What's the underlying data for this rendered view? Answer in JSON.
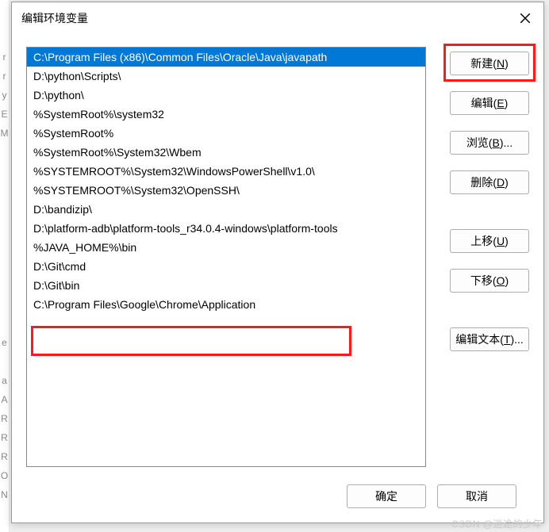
{
  "dialog": {
    "title": "编辑环境变量"
  },
  "list": {
    "items": [
      "C:\\Program Files (x86)\\Common Files\\Oracle\\Java\\javapath",
      "D:\\python\\Scripts\\",
      "D:\\python\\",
      "%SystemRoot%\\system32",
      "%SystemRoot%",
      "%SystemRoot%\\System32\\Wbem",
      "%SYSTEMROOT%\\System32\\WindowsPowerShell\\v1.0\\",
      "%SYSTEMROOT%\\System32\\OpenSSH\\",
      "D:\\bandizip\\",
      "D:\\platform-adb\\platform-tools_r34.0.4-windows\\platform-tools",
      "%JAVA_HOME%\\bin",
      "D:\\Git\\cmd",
      "D:\\Git\\bin",
      "C:\\Program Files\\Google\\Chrome\\Application"
    ],
    "selected_index": 0,
    "highlighted_index": 13
  },
  "buttons": {
    "new_label": "新建(",
    "new_key": "N",
    "edit_label": "编辑(",
    "edit_key": "E",
    "browse_label": "浏览(",
    "browse_key": "B",
    "delete_label": "删除(",
    "delete_key": "D",
    "moveup_label": "上移(",
    "moveup_key": "U",
    "movedown_label": "下移(",
    "movedown_key": "O",
    "edittext_label": "编辑文本(",
    "edittext_key": "T",
    "close_paren": ")",
    "ellipsis": "...",
    "ok": "确定",
    "cancel": "取消"
  },
  "bg_letters": [
    "r",
    "r",
    "y",
    "E",
    "M",
    "",
    "",
    "",
    "",
    "",
    "",
    "",
    "",
    "",
    "",
    "e",
    "",
    "a",
    "A",
    "R",
    "R",
    "R",
    "O",
    "N"
  ],
  "watermark": "CSDN @迷途的少年"
}
